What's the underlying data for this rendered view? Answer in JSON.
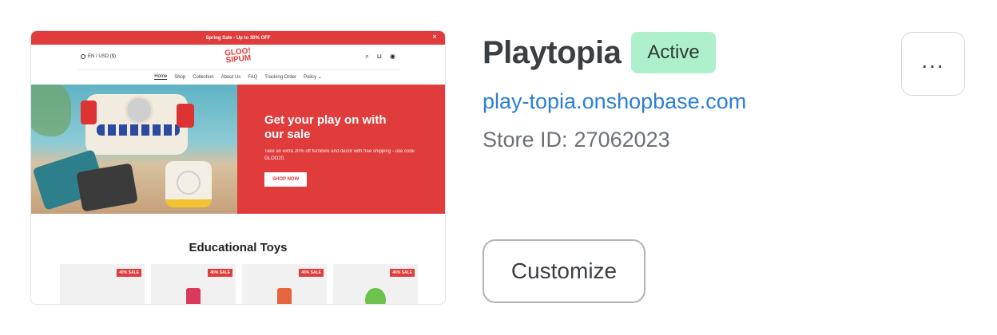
{
  "preview": {
    "announcement": "Spring Sale - Up to 30% OFF",
    "close_glyph": "×",
    "lang_currency": "EN / USD ($)",
    "logo_line1": "GLOO!",
    "logo_line2": "SIPUM",
    "nav": [
      "Home",
      "Shop",
      "Collection",
      "About Us",
      "FAQ",
      "Tracking Order",
      "Policy"
    ],
    "nav_dropdown_glyph": "⌄",
    "hero": {
      "title": "Get your play on with our sale",
      "subtitle": "Take an extra 20% off furniture and decor with free shipping - use code GLOO20.",
      "button": "SHOP NOW"
    },
    "section_title": "Educational Toys",
    "products": [
      {
        "badge": "40% SALE",
        "color": "#f2c230"
      },
      {
        "badge": "40% SALE",
        "color": "#d9395a"
      },
      {
        "badge": "40% SALE",
        "color": "#e8643c"
      },
      {
        "badge": "40% SALE",
        "color": "#6cc24a"
      }
    ]
  },
  "store": {
    "name": "Playtopia",
    "status": "Active",
    "url": "play-topia.onshopbase.com",
    "id_label": "Store ID:",
    "id_value": "27062023"
  },
  "actions": {
    "more_label": "...",
    "customize_label": "Customize"
  },
  "colors": {
    "accent_red": "#e03c3c",
    "badge_green": "#aef0cb",
    "link_blue": "#2c7ed6"
  }
}
